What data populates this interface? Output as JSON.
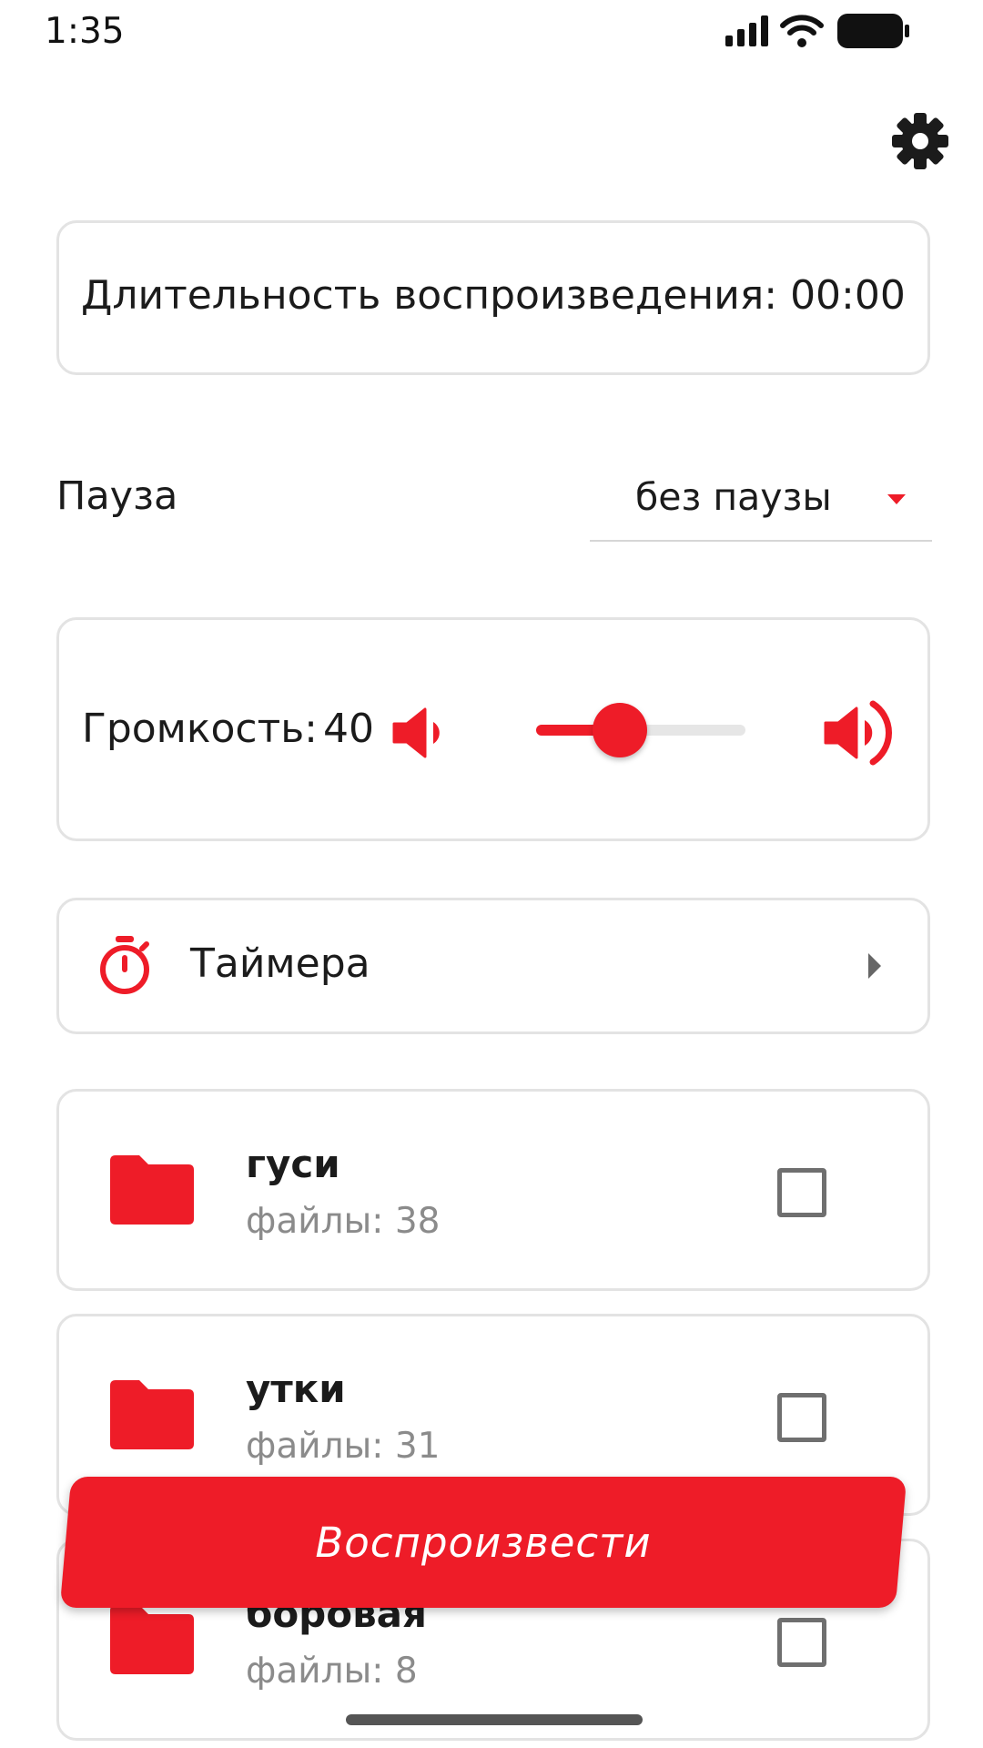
{
  "status_bar": {
    "time": "1:35"
  },
  "duration": {
    "text": "Длительность воспроизведения: 00:00"
  },
  "pause": {
    "label": "Пауза",
    "selected": "без паузы"
  },
  "volume": {
    "label": "Громкость:",
    "value": "40",
    "level_percent": 40
  },
  "timers": {
    "label": "Таймера"
  },
  "folders": [
    {
      "name": "гуси",
      "files": "файлы: 38",
      "checked": false
    },
    {
      "name": "утки",
      "files": "файлы: 31",
      "checked": false
    },
    {
      "name": "боровая",
      "files": "файлы: 8",
      "checked": false
    }
  ],
  "play": {
    "label": "Воспроизвести"
  },
  "colors": {
    "accent": "#ee1c28",
    "border": "#e3e3e3",
    "muted_text": "#8b8b8b"
  }
}
